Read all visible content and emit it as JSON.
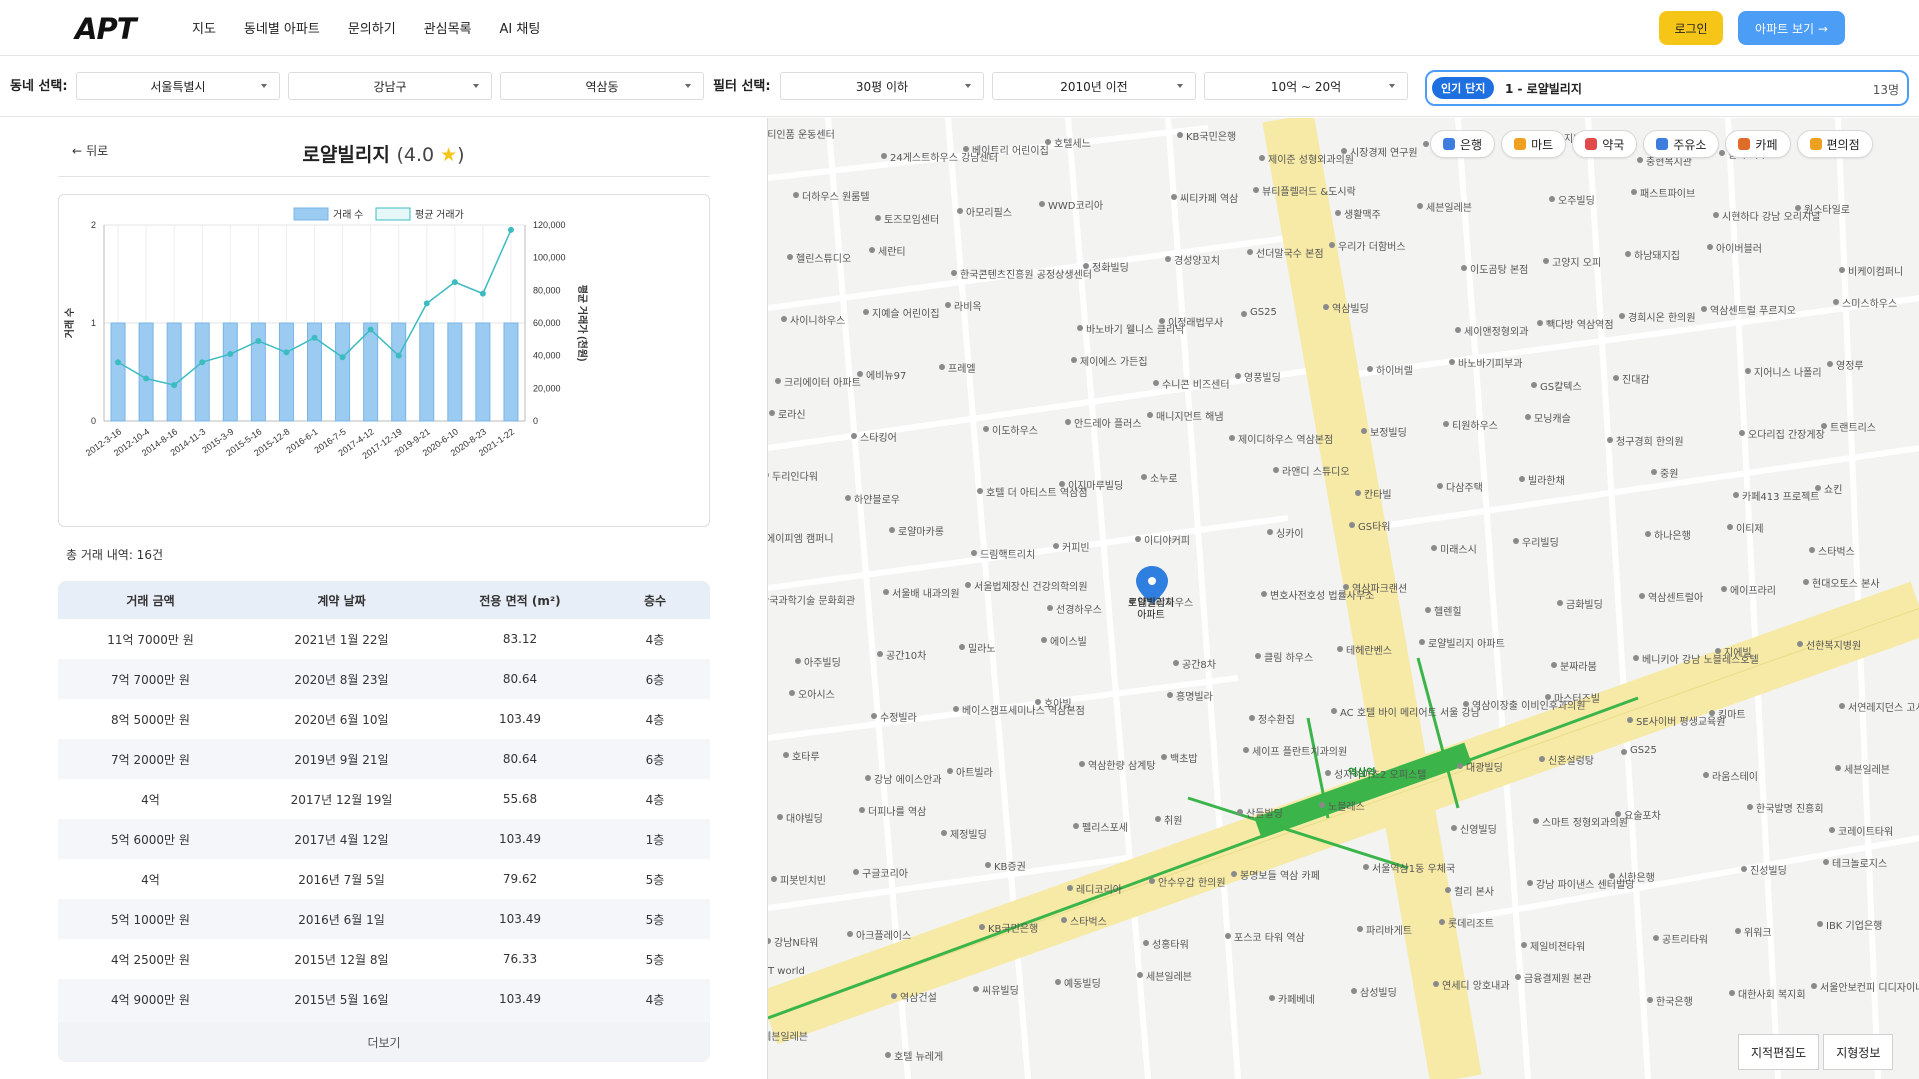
{
  "header": {
    "logo": "APT",
    "nav": [
      "지도",
      "동네별 아파트",
      "문의하기",
      "관심목록",
      "AI 채팅"
    ],
    "login": "로그인",
    "view_apt": "아파트 보기 →"
  },
  "filters": {
    "region_label": "동네 선택:",
    "city": "서울특별시",
    "district": "강남구",
    "dong": "역삼동",
    "filter_label": "필터 선택:",
    "size": "30평 이하",
    "year": "2010년 이전",
    "price": "10억 ~ 20억",
    "popular": {
      "tag": "인기 단지",
      "name": "1 - 로얄빌리지",
      "count": "13명"
    }
  },
  "detail": {
    "back": "뒤로",
    "name": "로얄빌리지",
    "rating": "(4.0 ",
    "rating_close": ")",
    "total_label": "총 거래 내역: 16건",
    "more": "더보기"
  },
  "chart_data": {
    "type": "bar",
    "categories": [
      "2012-3-16",
      "2012-10-4",
      "2014-8-16",
      "2014-11-3",
      "2015-3-9",
      "2015-5-16",
      "2015-12-8",
      "2016-6-1",
      "2016-7-5",
      "2017-4-12",
      "2017-12-19",
      "2019-9-21",
      "2020-6-10",
      "2020-8-23",
      "2021-1-22"
    ],
    "series": [
      {
        "name": "거래 수",
        "type": "bar",
        "axis": "left",
        "color": "#9ccbf2",
        "values": [
          1,
          1,
          1,
          1,
          1,
          1,
          1,
          1,
          1,
          1,
          1,
          1,
          1,
          1,
          1
        ]
      },
      {
        "name": "평균 거래가",
        "type": "line",
        "axis": "right",
        "color": "#3cbcc0",
        "values": [
          36000,
          26000,
          22000,
          36000,
          41000,
          49000,
          42000,
          51000,
          39000,
          56000,
          40000,
          72000,
          85000,
          78000,
          117000
        ]
      }
    ],
    "ylabel": "거래 수",
    "y2label": "평균 거래가 (천원)",
    "ylim": [
      0,
      2
    ],
    "y2lim": [
      0,
      120000
    ],
    "yticks": [
      "0",
      "1",
      "2"
    ],
    "y2ticks": [
      "0",
      "20,000",
      "40,000",
      "60,000",
      "80,000",
      "100,000",
      "120,000"
    ],
    "legend": "top-center",
    "grid": true
  },
  "table": {
    "headers": [
      "거래 금액",
      "계약 날짜",
      "전용 면적 (m²)",
      "층수"
    ],
    "rows": [
      [
        "11억 7000만 원",
        "2021년 1월 22일",
        "83.12",
        "4층"
      ],
      [
        "7억 7000만 원",
        "2020년 8월 23일",
        "80.64",
        "6층"
      ],
      [
        "8억 5000만 원",
        "2020년 6월 10일",
        "103.49",
        "4층"
      ],
      [
        "7억 2000만 원",
        "2019년 9월 21일",
        "80.64",
        "6층"
      ],
      [
        "4억",
        "2017년 12월 19일",
        "55.68",
        "4층"
      ],
      [
        "5억 6000만 원",
        "2017년 4월 12일",
        "103.49",
        "1층"
      ],
      [
        "4억",
        "2016년 7월 5일",
        "79.62",
        "5층"
      ],
      [
        "5억 1000만 원",
        "2016년 6월 1일",
        "103.49",
        "5층"
      ],
      [
        "4억 2500만 원",
        "2015년 12월 8일",
        "76.33",
        "5층"
      ],
      [
        "4억 9000만 원",
        "2015년 5월 16일",
        "103.49",
        "4층"
      ]
    ]
  },
  "map": {
    "chips": [
      {
        "label": "은행",
        "icon": "bank-icon",
        "color": "#3d7de0"
      },
      {
        "label": "마트",
        "icon": "cart-icon",
        "color": "#f0a020"
      },
      {
        "label": "약국",
        "icon": "pill-icon",
        "color": "#e04a4a"
      },
      {
        "label": "주유소",
        "icon": "gas-icon",
        "color": "#3d7de0"
      },
      {
        "label": "카페",
        "icon": "cup-icon",
        "color": "#e06a2a"
      },
      {
        "label": "편의점",
        "icon": "store-icon",
        "color": "#f0a020"
      }
    ],
    "tools": [
      "지적편집도",
      "지형정보"
    ],
    "selected_pin": "로얄빌리지\n아파트",
    "station": "역삼역",
    "labels": [
      "피티인품 운동센터",
      "24게스트하우스 강남센터",
      "베이트리 어린이집",
      "호텔세느",
      "KB국민은행",
      "제이준 성형외과의원",
      "시장경제 연구원",
      "두꺼운",
      "지니전복죽",
      "충현복지관",
      "칼라 하우스",
      "글로벌에이치",
      "더하우스 원룸텔",
      "토즈모임센터",
      "아모리필스",
      "WWD코리아",
      "씨티카페 역삼",
      "뷰티플렐러드 &도시락",
      "생활맥주",
      "세븐일레븐",
      "오주빌딩",
      "패스트파이브",
      "시현하다 강남 오리지널",
      "원스타일로",
      "헬린스튜디오",
      "세란티",
      "한국콘텐츠진흥원 공정상생센터",
      "정화빌딩",
      "경성양꼬치",
      "선더말국수 본점",
      "우리가 더함버스",
      "이도곰탕 본점",
      "고양지 오피",
      "하남돼지집",
      "아이버블러",
      "비케이컴퍼니",
      "사이니하우스",
      "지예슬 어린이집",
      "라비옥",
      "바노바기 웰니스 클리닉",
      "이정래법무사",
      "GS25",
      "역삼빌딩",
      "세이앤정형외과",
      "빽다방 역삼역점",
      "경희시온 한의원",
      "역삼센트럴 푸르지오",
      "스미스하우스",
      "크리에이터 아파트",
      "에비뉴97",
      "프레엘",
      "제이에스 가든집",
      "수니콘 비즈센터",
      "영풍빌딩",
      "하이버렐",
      "바노바기피부과",
      "GS칼텍스",
      "진대감",
      "지어니스 나폴리",
      "영정루",
      "로라신",
      "스타킹어",
      "이도하우스",
      "안드레아 플러스",
      "매니지먼트 해냄",
      "제이디하우스 역삼본점",
      "보정빌딩",
      "티원하우스",
      "모닝캐슬",
      "청구경희 한의원",
      "오다리집 간장게장",
      "트랜트리스",
      "두리인다워",
      "하얀블로우",
      "호텔 더 아티스트 역삼점",
      "이지마루빌딩",
      "소누로",
      "라앤디 스튜디오",
      "칸타빌",
      "다삼주택",
      "빌라한채",
      "중원",
      "카페413 프로젝트",
      "쇼킨",
      "에이피엠 캠퍼니",
      "로얄마카롱",
      "드림핵트리치",
      "커피빈",
      "이디야커피",
      "싱카이",
      "GS타워",
      "미래스시",
      "우리빌딩",
      "하나은행",
      "이티제",
      "스타벅스",
      "한국과학기술 문화회관",
      "서울배 내과의원",
      "서울법제장신 건강의학의원",
      "선경하우스",
      "대일합하우스",
      "변호사전호성 법률사무소",
      "역삼파크랜션",
      "헬렌힐",
      "금화빌딩",
      "역삼센트럴아",
      "에이프라리",
      "현대오토스 본사",
      "아주빌딩",
      "공간10차",
      "밀라노",
      "에이스빌",
      "공간8차",
      "클림 하우스",
      "테헤란벤스",
      "로얄빌리지 아파트",
      "분짜라붐",
      "베니키아 강남 노블레스호텔",
      "지에빌",
      "선한복지병원",
      "오아시스",
      "수정빌라",
      "베이스캠프세미나스 역삼본점",
      "호아빙",
      "흥명빌라",
      "정수환집",
      "AC 호텔 바이 메리어트 서울 강남",
      "역삼이장출 이비인후과의원",
      "마스터즈빌",
      "SE사이버 평생교육원",
      "킹마트",
      "서연레지던스 고시텔",
      "호타루",
      "강남 에이스안과",
      "아트빌라",
      "역삼한량 삼계탕",
      "백초밥",
      "세이프 플란트치과의원",
      "성지하이츠2 오피스텔",
      "대광빌딩",
      "신혼설렁탕",
      "GS25",
      "라움스테이",
      "세븐일레븐",
      "대야빌딩",
      "더피나를 역삼",
      "제정빌딩",
      "펠리스포세",
      "취원",
      "산들빌딩",
      "노블레스",
      "신영빌딩",
      "스마트 정형외과의원",
      "요술포차",
      "한국발명 진흥회",
      "코레이트타워",
      "피봇빈치빈",
      "구글코리아",
      "KB증권",
      "레디코리아",
      "안수우갑 한의원",
      "봉명보들 역삼 카페",
      "서울역삼1동 우체국",
      "컬리 본사",
      "강남 파이낸스 센터빌딩",
      "신한은행",
      "진성빌딩",
      "테크놀로지스",
      "강남N타워",
      "아크플레이스",
      "KB국민은행",
      "스타벅스",
      "성홍타워",
      "포스코 타워 역삼",
      "파리바게트",
      "롯데리조트",
      "제일비젼타워",
      "공트리타워",
      "위워크",
      "IBK 기업은행",
      "T world",
      "역삼건설",
      "씨유빌딩",
      "예동빌딩",
      "세븐일레븐",
      "카페베네",
      "삼성빌딩",
      "연세디 앙호내과",
      "금융결제원 본관",
      "한국은행",
      "대한사회 복지회",
      "서울안보컨피 디디자이너스",
      "세븐일레븐",
      "호텔 뉴레게"
    ]
  }
}
